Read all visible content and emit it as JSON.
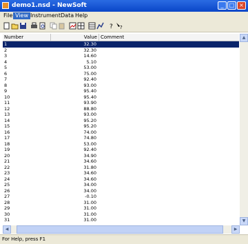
{
  "window": {
    "title": "demo1.nsd - NewSoft",
    "minimize_label": "_",
    "maximize_label": "□",
    "close_label": "×"
  },
  "menu": [
    {
      "label": "File"
    },
    {
      "label": "View"
    },
    {
      "label": "Instrument"
    },
    {
      "label": "Data"
    },
    {
      "label": "Help"
    }
  ],
  "toolbar": {
    "icons": [
      "new-file-icon",
      "open-folder-icon",
      "save-icon",
      "print-icon",
      "print-preview-icon",
      "copy-icon",
      "paste-icon",
      "chart-icon",
      "grid-icon",
      "table-icon",
      "graph-icon",
      "help-icon",
      "context-help-icon"
    ]
  },
  "table": {
    "columns": [
      "Number",
      "Value",
      "Comment"
    ],
    "rows": [
      {
        "number": "1",
        "value": "32.30"
      },
      {
        "number": "2",
        "value": "32.30"
      },
      {
        "number": "3",
        "value": "14.60"
      },
      {
        "number": "4",
        "value": "5.10"
      },
      {
        "number": "5",
        "value": "53.00"
      },
      {
        "number": "6",
        "value": "75.00"
      },
      {
        "number": "7",
        "value": "92.40"
      },
      {
        "number": "8",
        "value": "93.00"
      },
      {
        "number": "9",
        "value": "95.40"
      },
      {
        "number": "10",
        "value": "95.40"
      },
      {
        "number": "11",
        "value": "93.90"
      },
      {
        "number": "12",
        "value": "88.80"
      },
      {
        "number": "13",
        "value": "93.00"
      },
      {
        "number": "14",
        "value": "95.20"
      },
      {
        "number": "15",
        "value": "95.20"
      },
      {
        "number": "16",
        "value": "74.00"
      },
      {
        "number": "17",
        "value": "74.80"
      },
      {
        "number": "18",
        "value": "53.00"
      },
      {
        "number": "19",
        "value": "92.40"
      },
      {
        "number": "20",
        "value": "34.90"
      },
      {
        "number": "21",
        "value": "34.60"
      },
      {
        "number": "22",
        "value": "31.80"
      },
      {
        "number": "23",
        "value": "34.60"
      },
      {
        "number": "24",
        "value": "34.60"
      },
      {
        "number": "25",
        "value": "34.00"
      },
      {
        "number": "26",
        "value": "34.00"
      },
      {
        "number": "27",
        "value": "-0.10"
      },
      {
        "number": "28",
        "value": "31.00"
      },
      {
        "number": "29",
        "value": "31.00"
      },
      {
        "number": "30",
        "value": "31.00"
      },
      {
        "number": "31",
        "value": "31.00"
      }
    ]
  },
  "status": {
    "text": "For Help, press F1"
  }
}
